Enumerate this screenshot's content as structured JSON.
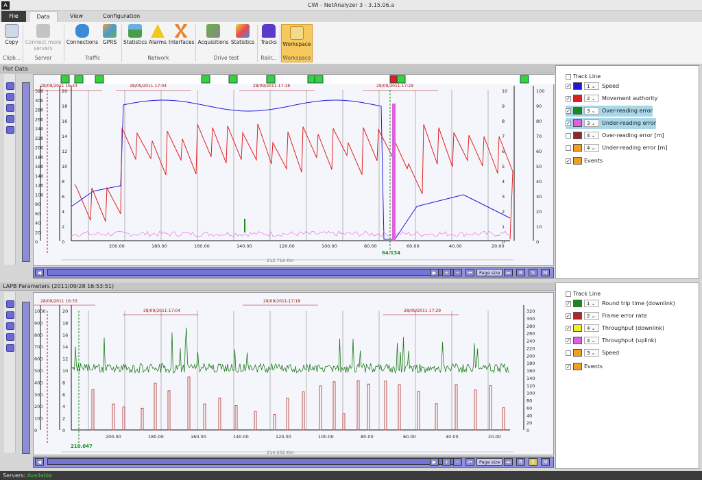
{
  "window": {
    "title": "CWI - NetAnalyzer 3 - 3.15.06.a"
  },
  "tabs": [
    "File",
    "Data",
    "View",
    "Configuration"
  ],
  "ribbon": {
    "buttons": [
      "Copy",
      "Connect more servers",
      "Connections",
      "GPRS",
      "Statistics",
      "Alarms",
      "Interfaces",
      "Acquisitions",
      "Statistics",
      "Tracks",
      "Workspace"
    ],
    "groups": [
      "Clipb...",
      "Server",
      "Traffic",
      "Network",
      "Drive test",
      "Railr...",
      "Workspace"
    ]
  },
  "plot1": {
    "header": "Plot Data",
    "y_left_outer": [
      "320",
      "300",
      "280",
      "260",
      "240",
      "220",
      "200",
      "180",
      "160",
      "140",
      "120",
      "100",
      "80",
      "60",
      "40",
      "20",
      "0"
    ],
    "y_left_inner": [
      "20",
      "18",
      "16",
      "14",
      "12",
      "10",
      "8",
      "6",
      "4",
      "2",
      "0"
    ],
    "y_right_inner": [
      "10",
      "9",
      "8",
      "7",
      "6",
      "5",
      "4",
      "3",
      "2",
      "1",
      "0"
    ],
    "y_right_outer": [
      "100",
      "90",
      "80",
      "70",
      "60",
      "50",
      "40",
      "30",
      "20",
      "10",
      "0"
    ],
    "x_ticks": [
      "200.00",
      "180.00",
      "160.00",
      "140.00",
      "120.00",
      "100.00",
      "80.00",
      "60.00",
      "40.00",
      "20.00"
    ],
    "dates": [
      "28/09/2011 16:33",
      "28/09/2011-17:04",
      "28/09/2011-17:18",
      "28/09/2011-17:29"
    ],
    "cursor_value": "64.134",
    "distance": "212.716 Km",
    "page_size": "Page size"
  },
  "plot2": {
    "header": "LAPB Parameters (2011/09/28 16:53:51)",
    "y_left_outer": [
      "1000",
      "900",
      "800",
      "700",
      "600",
      "500",
      "400",
      "300",
      "200",
      "100",
      "0"
    ],
    "y_left_inner": [
      "20",
      "18",
      "16",
      "14",
      "12",
      "10",
      "8",
      "6",
      "4",
      "2",
      "0"
    ],
    "y_right": [
      "320",
      "300",
      "280",
      "260",
      "240",
      "220",
      "200",
      "180",
      "160",
      "140",
      "120",
      "100",
      "80",
      "60",
      "40",
      "20",
      "0"
    ],
    "x_ticks": [
      "200.00",
      "180.00",
      "160.00",
      "140.00",
      "120.00",
      "100.00",
      "80.00",
      "60.00",
      "40.00",
      "20.00"
    ],
    "dates": [
      "28/09/2011 16:33",
      "28/09/2011-17:04",
      "28/09/2011-17:18",
      "28/09/2011-17:29"
    ],
    "cursor_value": "210.047",
    "distance": "214.502 Km",
    "page_size": "Page size"
  },
  "legend1": {
    "track_line": "Track Line",
    "items": [
      {
        "label": "Speed",
        "num": "1",
        "color": "#1a1ad8",
        "checked": true,
        "hl": false
      },
      {
        "label": "Movement authority",
        "num": "2",
        "color": "#e02020",
        "checked": true,
        "hl": false
      },
      {
        "label": "Over-reading error",
        "num": "3",
        "color": "#1b8a1b",
        "checked": true,
        "hl": true
      },
      {
        "label": "Under-reading error",
        "num": "3",
        "color": "#e060e0",
        "checked": true,
        "hl": true
      },
      {
        "label": "Over-reading error [m]",
        "num": "4",
        "color": "#8b2a2a",
        "checked": false,
        "hl": false
      },
      {
        "label": "Under-reading error [m]",
        "num": "4",
        "color": "#f0a020",
        "checked": false,
        "hl": false
      }
    ],
    "events": "Events"
  },
  "legend2": {
    "track_line": "Track Line",
    "items": [
      {
        "label": "Round trip time (downlink)",
        "num": "1",
        "color": "#1b8a1b",
        "checked": true
      },
      {
        "label": "Frame error rate",
        "num": "2",
        "color": "#b02828",
        "checked": true
      },
      {
        "label": "Throughput (downlink)",
        "num": "4",
        "color": "#f0f020",
        "checked": true
      },
      {
        "label": "Throughput (uplink)",
        "num": "4",
        "color": "#e060e0",
        "checked": true
      },
      {
        "label": "Speed",
        "num": "3",
        "color": "#f0a020",
        "checked": false
      }
    ],
    "events": "Events"
  },
  "status": {
    "label": "Servers:",
    "value": "Available"
  }
}
